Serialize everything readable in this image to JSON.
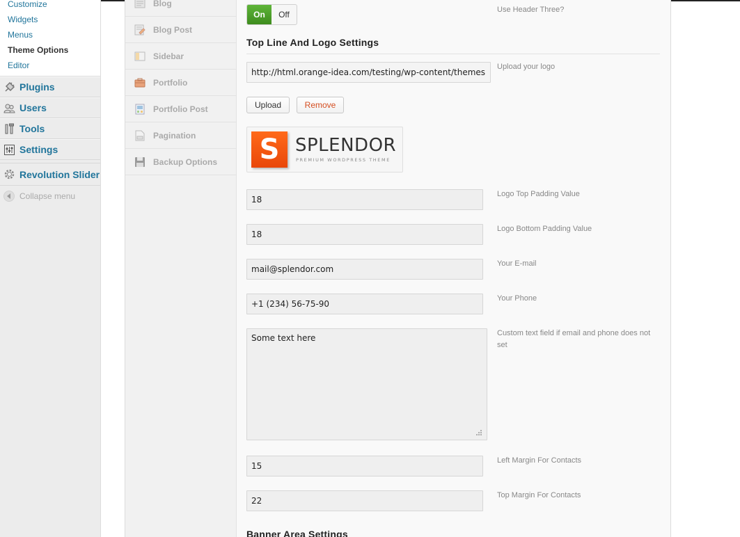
{
  "admin_menu": {
    "submenu": [
      "Customize",
      "Widgets",
      "Menus",
      "Theme Options",
      "Editor"
    ],
    "items": [
      {
        "label": "Plugins",
        "icon": "plugin-icon"
      },
      {
        "label": "Users",
        "icon": "users-icon"
      },
      {
        "label": "Tools",
        "icon": "tools-icon"
      },
      {
        "label": "Settings",
        "icon": "settings-icon"
      },
      {
        "label": "Revolution Slider",
        "icon": "gear-icon"
      }
    ],
    "collapse_label": "Collapse menu"
  },
  "options_nav": [
    "Blog",
    "Blog Post",
    "Sidebar",
    "Portfolio",
    "Portfolio Post",
    "Pagination",
    "Backup Options"
  ],
  "header_three": {
    "on_label": "On",
    "off_label": "Off",
    "state": "on",
    "description": "Use Header Three?"
  },
  "top_line": {
    "title": "Top Line And Logo Settings",
    "logo_url": "http://html.orange-idea.com/testing/wp-content/themes",
    "logo_url_desc": "Upload your logo",
    "upload_label": "Upload",
    "remove_label": "Remove",
    "logo_preview": {
      "letter": "S",
      "name": "SPLENDOR",
      "tagline": "PREMIUM WORDPRESS THEME"
    },
    "logo_top_padding": {
      "value": "18",
      "label": "Logo Top Padding Value"
    },
    "logo_bottom_padding": {
      "value": "18",
      "label": "Logo Bottom Padding Value"
    },
    "email": {
      "value": "mail@splendor.com",
      "label": "Your E-mail"
    },
    "phone": {
      "value": "+1 (234) 56-75-90",
      "label": "Your Phone"
    },
    "custom_text": {
      "value": "Some text here",
      "label": "Custom text field if email and phone does not set"
    },
    "left_margin": {
      "value": "15",
      "label": "Left Margin For Contacts"
    },
    "top_margin": {
      "value": "22",
      "label": "Top Margin For Contacts"
    }
  },
  "banner_area": {
    "title": "Banner Area Settings"
  },
  "colors": {
    "link": "#21759b",
    "toggle_on": "#4a9e27",
    "remove": "#d54e21",
    "logo_orange": "#f15a0f"
  }
}
